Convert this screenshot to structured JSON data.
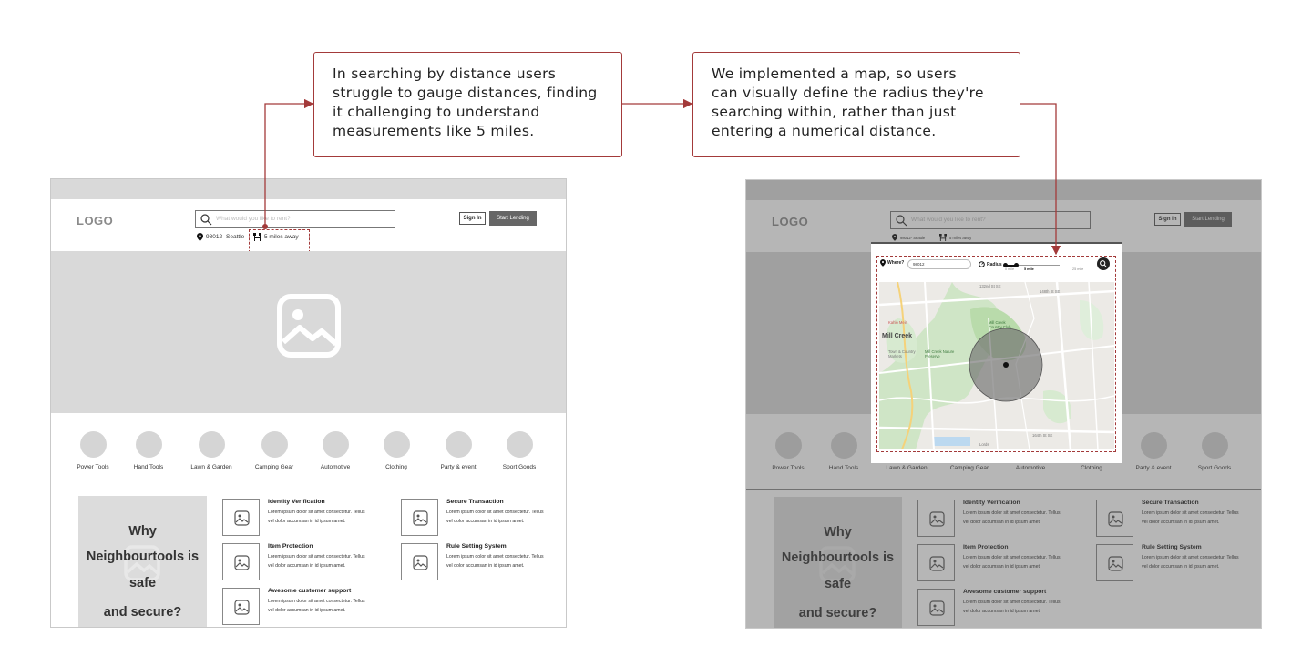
{
  "annotations": {
    "problem_lines": [
      "In searching by distance users",
      "struggle to gauge distances, finding",
      "it challenging to understand",
      "measurements like 5 miles."
    ],
    "solution_lines": [
      "We implemented a map, so users",
      "can visually define the radius they're",
      "searching within, rather than just",
      "entering a numerical distance."
    ],
    "accent_color": "#a33a3a"
  },
  "header": {
    "logo": "LOGO",
    "search_placeholder": "What would you like to rent?",
    "location": "98012- Seattle",
    "distance": "5 miles away",
    "sign_in": "Sign In",
    "start_lending": "Start Lending"
  },
  "hero": {
    "image_icon": "image-placeholder-icon"
  },
  "categories": [
    "Power Tools",
    "Hand Tools",
    "Lawn & Garden",
    "Camping Gear",
    "Automotive",
    "Clothing",
    "Party & event",
    "Sport Goods"
  ],
  "why_lines": [
    "Why",
    "Neighbourtools is",
    "safe",
    "and secure?"
  ],
  "features": [
    {
      "title": "Identity Verification",
      "desc": "Lorem ipsum dolor sit amet consectetur. Tellus vel dolor accumsan in id ipsum amet."
    },
    {
      "title": "Secure Transaction",
      "desc": "Lorem ipsum dolor sit amet consectetur. Tellus vel dolor accumsan in id ipsum amet."
    },
    {
      "title": "Item Protection",
      "desc": "Lorem ipsum dolor sit amet consectetur. Tellus vel dolor accumsan in id ipsum amet."
    },
    {
      "title": "Rule Setting System",
      "desc": "Lorem ipsum dolor sit amet consectetur. Tellus vel dolor accumsan in id ipsum amet."
    },
    {
      "title": "Awesome customer support",
      "desc": "Lorem ipsum dolor sit amet consectetur. Tellus vel dolor accumsan in id ipsum amet."
    }
  ],
  "map_panel": {
    "where_label": "Where?",
    "where_value": "98012",
    "radius_label": "Radius",
    "slider_min": "0 mile",
    "slider_value": "5 mile",
    "slider_max": "25 mile",
    "slider_fraction": 0.2,
    "map_labels": [
      "Mill Creek",
      "Mill Creek Country Club",
      "Town & Country Markets",
      "Mill Creek Nature Preserve",
      "Kahlo Mein",
      "148th St SE",
      "164th St SE",
      "132nd St SE",
      "Lords"
    ]
  }
}
